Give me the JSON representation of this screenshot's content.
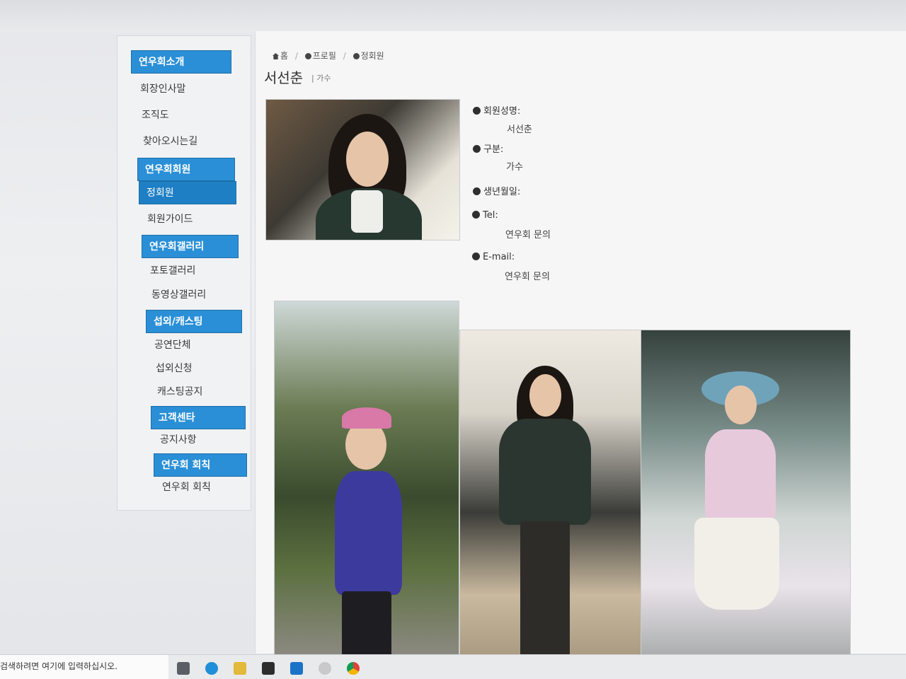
{
  "sidebar": {
    "sections": [
      {
        "head": "연우회소개",
        "items": [
          "회장인사말",
          "조직도",
          "찾아오시는길"
        ]
      },
      {
        "head": "연우회회원",
        "active_item": "정회원",
        "items": [
          "회원가이드"
        ]
      },
      {
        "head": "연우회갤러리",
        "items": [
          "포토갤러리",
          "동영상갤러리"
        ]
      },
      {
        "head": "섭외/캐스팅",
        "items": [
          "공연단체",
          "섭외신청",
          "캐스팅공지"
        ]
      },
      {
        "head": "고객센타",
        "items": [
          "공지사항"
        ]
      },
      {
        "head": "연우회 회칙",
        "items": [
          "연우회 회칙"
        ]
      }
    ]
  },
  "breadcrumb": [
    "홈",
    "프로필",
    "정회원"
  ],
  "profile": {
    "name": "서선춘",
    "category": "| 가수",
    "fields": [
      {
        "label": "회원성명:",
        "value": "서선춘"
      },
      {
        "label": "구분:",
        "value": "가수"
      },
      {
        "label": "생년월일:",
        "value": ""
      },
      {
        "label": "Tel:",
        "value": "연우회 문의"
      },
      {
        "label": "E-mail:",
        "value": "연우회 문의"
      }
    ]
  },
  "taskbar": {
    "search_placeholder": "검색하려면 여기에 입력하십시오."
  },
  "colors": {
    "sidebar_header": "#2a8fd6",
    "page_bg": "#f6f6f7"
  }
}
